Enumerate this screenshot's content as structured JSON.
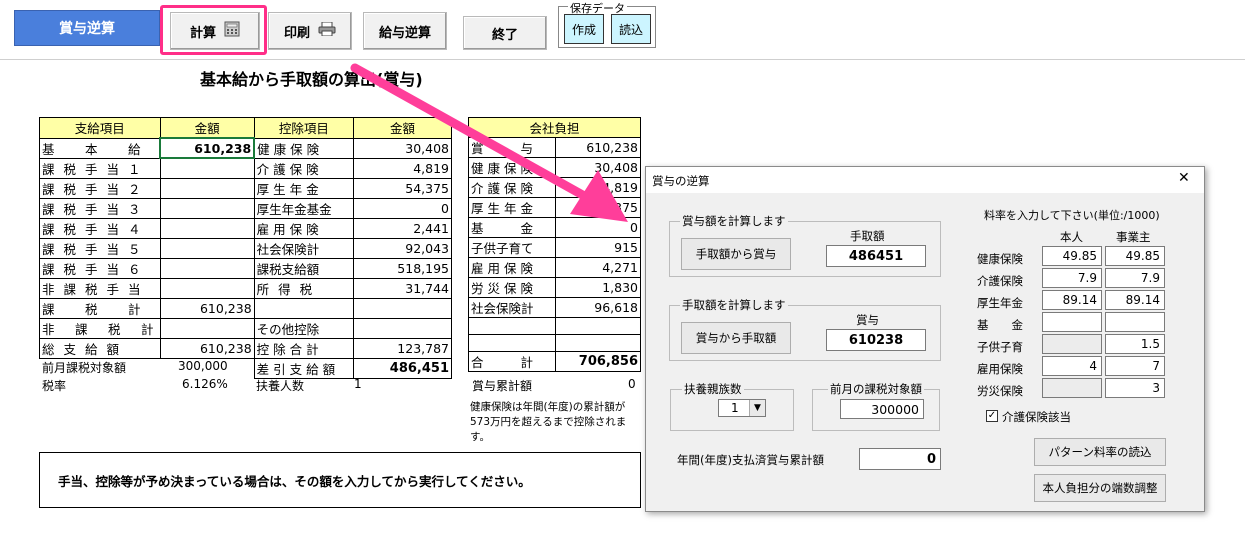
{
  "toolbar": {
    "title": "賞与逆算",
    "calc": "計算",
    "print": "印刷",
    "salary_reverse": "給与逆算",
    "exit": "終了",
    "save_legend": "保存データ",
    "create": "作成",
    "load": "読込"
  },
  "heading": "基本給から手取額の算出(賞与)",
  "pay_table": {
    "headers": [
      "支給項目",
      "金額",
      "控除項目",
      "金額"
    ],
    "rows": [
      [
        "基　本　給",
        "610,238",
        "健康保険",
        "30,408"
      ],
      [
        "課税手当１",
        "",
        "介護保険",
        "4,819"
      ],
      [
        "課税手当２",
        "",
        "厚生年金",
        "54,375"
      ],
      [
        "課税手当３",
        "",
        "厚生年金基金",
        "0"
      ],
      [
        "課税手当４",
        "",
        "雇用保険",
        "2,441"
      ],
      [
        "課税手当５",
        "",
        "社会保険計",
        "92,043"
      ],
      [
        "課税手当６",
        "",
        "課税支給額",
        "518,195"
      ],
      [
        "非課税手当",
        "",
        "所得税",
        "31,744"
      ],
      [
        "課　税　計",
        "610,238",
        "",
        ""
      ],
      [
        "非　課　税　計",
        "",
        "その他控除",
        ""
      ],
      [
        "総支給額",
        "610,238",
        "控除合計",
        "123,787"
      ]
    ],
    "net_label": "差引支給額",
    "net_value": "486,451"
  },
  "company_table": {
    "header": "会社負担",
    "rows": [
      [
        "賞　　与",
        "610,238"
      ],
      [
        "健康保険",
        "30,408"
      ],
      [
        "介護保険",
        "4,819"
      ],
      [
        "厚生年金",
        "54,375"
      ],
      [
        "基　　金",
        "0"
      ],
      [
        "子供子育て",
        "915"
      ],
      [
        "雇用保険",
        "4,271"
      ],
      [
        "労災保険",
        "1,830"
      ],
      [
        "社会保険計",
        "96,618"
      ],
      [
        "",
        ""
      ],
      [
        "",
        ""
      ]
    ],
    "total_label": "合　　計",
    "total_value": "706,856"
  },
  "info": {
    "prev_taxable_label": "前月課税対象額",
    "prev_taxable_value": "300,000",
    "tax_rate_label": "税率",
    "tax_rate_value": "6.126%",
    "dependents_label": "扶養人数",
    "dependents_value": "1",
    "bonus_total_label": "賞与累計額",
    "bonus_total_value": "0",
    "health_note": "健康保険は年間(年度)の累計額が573万円を超えるまで控除されます。"
  },
  "message": "手当、控除等が予め決まっている場合は、その額を入力してから実行してください。",
  "dialog": {
    "title": "賞与の逆算",
    "close": "✕",
    "group1_label": "賞与額を計算します",
    "net_to_bonus_btn": "手取額から賞与",
    "net_amount_label": "手取額",
    "net_amount_value": "486451",
    "group2_label": "手取額を計算します",
    "bonus_to_net_btn": "賞与から手取額",
    "bonus_label": "賞与",
    "bonus_value": "610238",
    "dependents_label": "扶養親族数",
    "dependents_value": "1",
    "prev_taxable_label": "前月の課税対象額",
    "prev_taxable_value": "300000",
    "annual_paid_label": "年間(年度)支払済賞与累計額",
    "annual_paid_value": "0",
    "rate_title": "料率を入力して下さい(単位:/1000)",
    "col_self": "本人",
    "col_employer": "事業主",
    "rates": [
      {
        "label": "健康保険",
        "self": "49.85",
        "employer": "49.85",
        "self_disabled": false
      },
      {
        "label": "介護保険",
        "self": "7.9",
        "employer": "7.9",
        "self_disabled": false
      },
      {
        "label": "厚生年金",
        "self": "89.14",
        "employer": "89.14",
        "self_disabled": false
      },
      {
        "label": "基　　金",
        "self": "",
        "employer": "",
        "self_disabled": false
      },
      {
        "label": "子供子育",
        "self": "",
        "employer": "1.5",
        "self_disabled": true
      },
      {
        "label": "雇用保険",
        "self": "4",
        "employer": "7",
        "self_disabled": false
      },
      {
        "label": "労災保険",
        "self": "",
        "employer": "3",
        "self_disabled": true
      }
    ],
    "care_checkbox_label": "介護保険該当",
    "pattern_btn": "パターン料率の読込",
    "rounding_btn": "本人負担分の端数調整"
  }
}
